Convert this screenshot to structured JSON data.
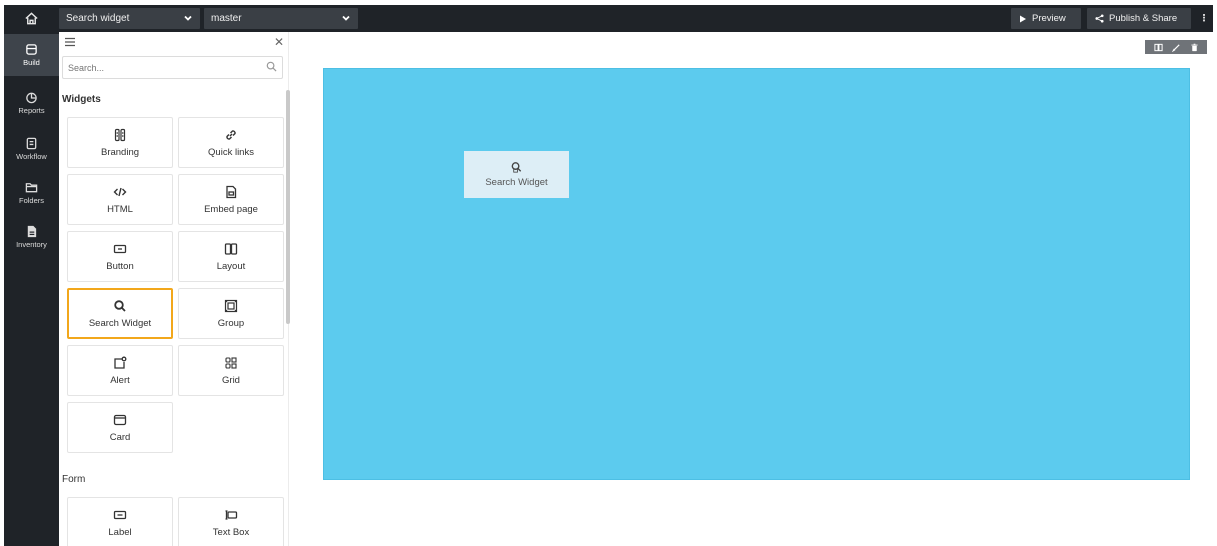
{
  "topbar": {
    "widget_select": "Search widget",
    "branch_select": "master",
    "preview_label": "Preview",
    "publish_label": "Publish & Share",
    "more_label": "⋮"
  },
  "rail": [
    {
      "label": "Build",
      "icon": "build-icon",
      "active": true
    },
    {
      "label": "Reports",
      "icon": "reports-icon"
    },
    {
      "label": "Workflow",
      "icon": "workflow-icon"
    },
    {
      "label": "Folders",
      "icon": "folder-icon"
    },
    {
      "label": "Inventory",
      "icon": "inventory-icon"
    }
  ],
  "panel": {
    "search_placeholder": "Search...",
    "sections": {
      "widgets": "Widgets",
      "form": "Form"
    },
    "widgets": [
      {
        "label": "Branding",
        "icon": "branding-icon"
      },
      {
        "label": "Quick links",
        "icon": "link-icon"
      },
      {
        "label": "HTML",
        "icon": "code-icon"
      },
      {
        "label": "Embed page",
        "icon": "embed-page-icon"
      },
      {
        "label": "Button",
        "icon": "button-icon"
      },
      {
        "label": "Layout",
        "icon": "layout-icon"
      },
      {
        "label": "Search Widget",
        "icon": "search-icon",
        "selected": true
      },
      {
        "label": "Group",
        "icon": "group-icon"
      },
      {
        "label": "Alert",
        "icon": "alert-icon"
      },
      {
        "label": "Grid",
        "icon": "grid-icon"
      },
      {
        "label": "Card",
        "icon": "card-icon"
      }
    ],
    "form_widgets": [
      {
        "label": "Label",
        "icon": "label-icon"
      },
      {
        "label": "Text Box",
        "icon": "text-box-icon"
      }
    ]
  },
  "canvas": {
    "drag_widget_label": "Search Widget",
    "block_color": "#5ccbee",
    "accent_selected": "#f2a71b"
  }
}
